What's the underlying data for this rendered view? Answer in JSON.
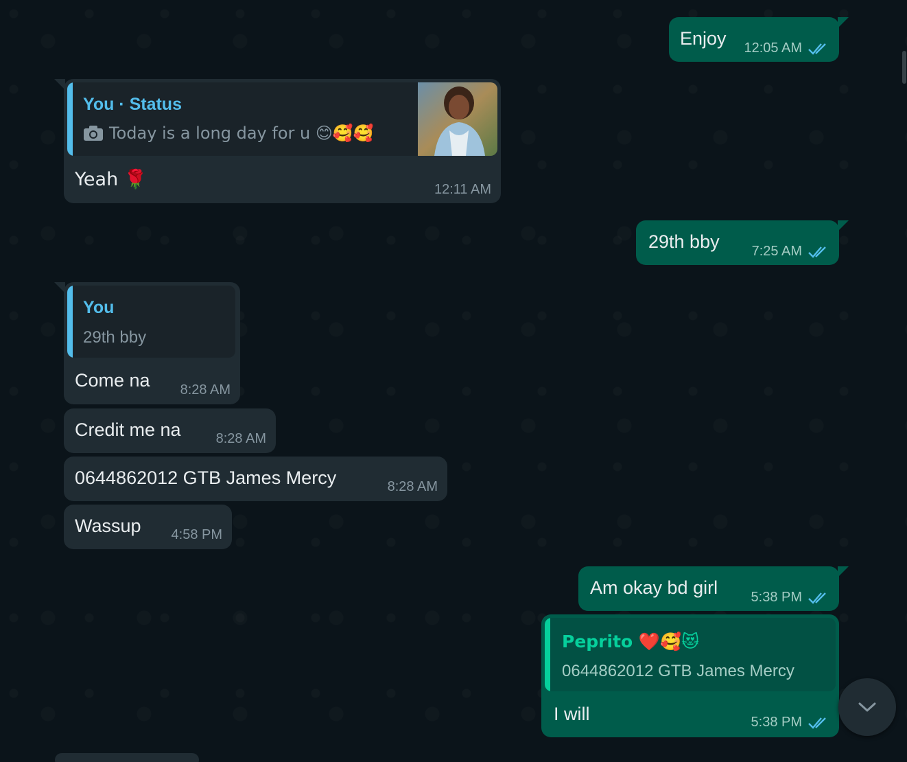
{
  "messages": [
    {
      "id": "m1",
      "direction": "out",
      "text": "Enjoy",
      "time": "12:05 AM",
      "status": "read"
    },
    {
      "id": "m2",
      "direction": "in",
      "quote": {
        "title": "You · Status",
        "text": "Today is a long day for u 😊🥰🥰",
        "has_photo": true
      },
      "text": "Yeah 🌹",
      "time": "12:11 AM"
    },
    {
      "id": "m3",
      "direction": "out",
      "text": "29th bby",
      "time": "7:25 AM",
      "status": "read"
    },
    {
      "id": "m4",
      "direction": "in",
      "quote": {
        "title": "You",
        "text": "29th bby"
      },
      "text": "Come na",
      "time": "8:28 AM"
    },
    {
      "id": "m5",
      "direction": "in",
      "text": "Credit me na",
      "time": "8:28 AM"
    },
    {
      "id": "m6",
      "direction": "in",
      "text": "0644862012 GTB James Mercy",
      "time": "8:28 AM"
    },
    {
      "id": "m7",
      "direction": "in",
      "text": "Wassup",
      "time": "4:58 PM"
    },
    {
      "id": "m8",
      "direction": "out",
      "text": "Am okay bd girl",
      "time": "5:38 PM",
      "status": "read"
    },
    {
      "id": "m9",
      "direction": "out",
      "quote": {
        "title": "Peprito ❤️🥰😻",
        "text": "0644862012 GTB James Mercy"
      },
      "text": "I will",
      "time": "5:38 PM",
      "status": "read"
    }
  ],
  "colors": {
    "background": "#0b141a",
    "incoming_bubble": "#202c33",
    "outgoing_bubble": "#005c4b",
    "read_ticks": "#53bdeb",
    "quote_status_accent": "#53bdeb",
    "quote_contact_accent": "#06cf9c"
  },
  "icons": {
    "read_receipt": "double-check-icon",
    "camera": "camera-icon",
    "scroll_down": "chevron-down-icon"
  }
}
